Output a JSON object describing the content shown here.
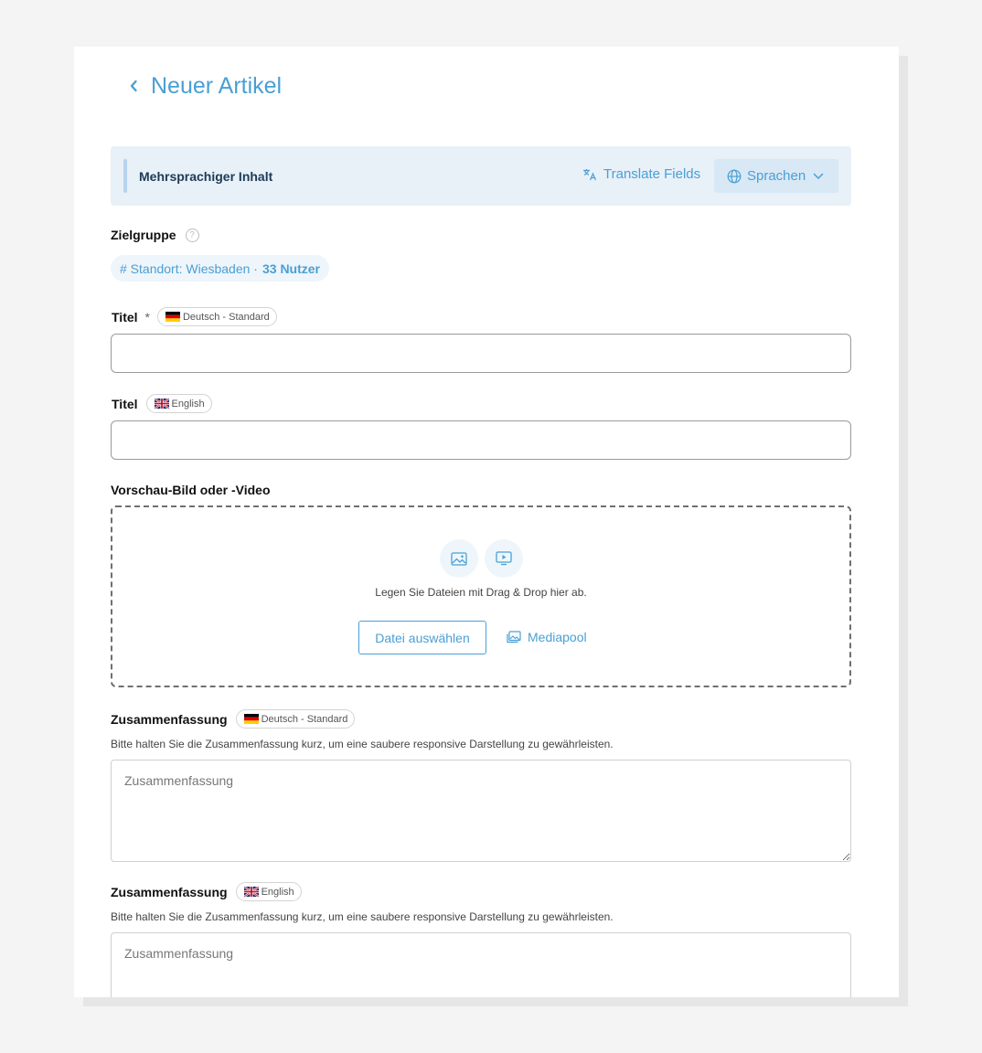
{
  "header": {
    "title": "Neuer Artikel"
  },
  "banner": {
    "label": "Mehrsprachiger Inhalt",
    "translate_label": "Translate Fields",
    "languages_label": "Sprachen"
  },
  "audience": {
    "label": "Zielgruppe",
    "help": "?",
    "chip_location": "# Standort: Wiesbaden ·",
    "chip_count": "33 Nutzer"
  },
  "title_de": {
    "label": "Titel",
    "required": "*",
    "lang": "Deutsch - Standard",
    "value": ""
  },
  "title_en": {
    "label": "Titel",
    "lang": "English",
    "value": ""
  },
  "preview": {
    "label": "Vorschau-Bild oder -Video",
    "drop_text": "Legen Sie Dateien mit Drag & Drop hier ab.",
    "file_button": "Datei auswählen",
    "mediapool": "Mediapool"
  },
  "summary_de": {
    "label": "Zusammenfassung",
    "lang": "Deutsch - Standard",
    "hint": "Bitte halten Sie die Zusammenfassung kurz, um eine saubere responsive Darstellung zu gewährleisten.",
    "placeholder": "Zusammenfassung"
  },
  "summary_en": {
    "label": "Zusammenfassung",
    "lang": "English",
    "hint": "Bitte halten Sie die Zusammenfassung kurz, um eine saubere responsive Darstellung zu gewährleisten.",
    "placeholder": "Zusammenfassung"
  },
  "colors": {
    "accent": "#4a9fd4",
    "banner_bg": "#e8f0f8"
  }
}
